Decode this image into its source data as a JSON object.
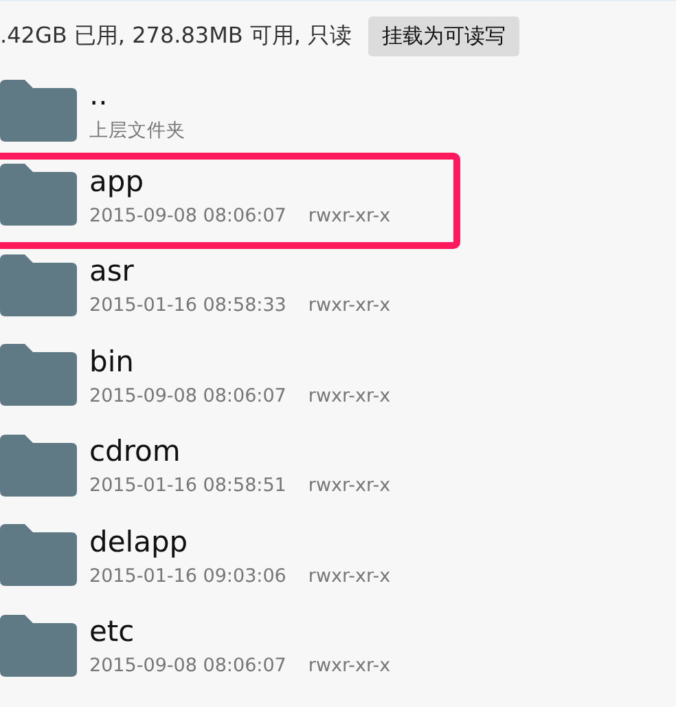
{
  "storage_bar": {
    "info": ".42GB 已用, 278.83MB 可用, 只读",
    "button": "挂载为可读写"
  },
  "files": [
    {
      "name": "..",
      "subtitle": "上层文件夹",
      "highlighted": false
    },
    {
      "name": "app",
      "date": "2015-09-08 08:06:07",
      "permissions": "rwxr-xr-x",
      "highlighted": true
    },
    {
      "name": "asr",
      "date": "2015-01-16 08:58:33",
      "permissions": "rwxr-xr-x",
      "highlighted": false
    },
    {
      "name": "bin",
      "date": "2015-09-08 08:06:07",
      "permissions": "rwxr-xr-x",
      "highlighted": false
    },
    {
      "name": "cdrom",
      "date": "2015-01-16 08:58:51",
      "permissions": "rwxr-xr-x",
      "highlighted": false
    },
    {
      "name": "delapp",
      "date": "2015-01-16 09:03:06",
      "permissions": "rwxr-xr-x",
      "highlighted": false
    },
    {
      "name": "etc",
      "date": "2015-09-08 08:06:07",
      "permissions": "rwxr-xr-x",
      "highlighted": false
    }
  ]
}
